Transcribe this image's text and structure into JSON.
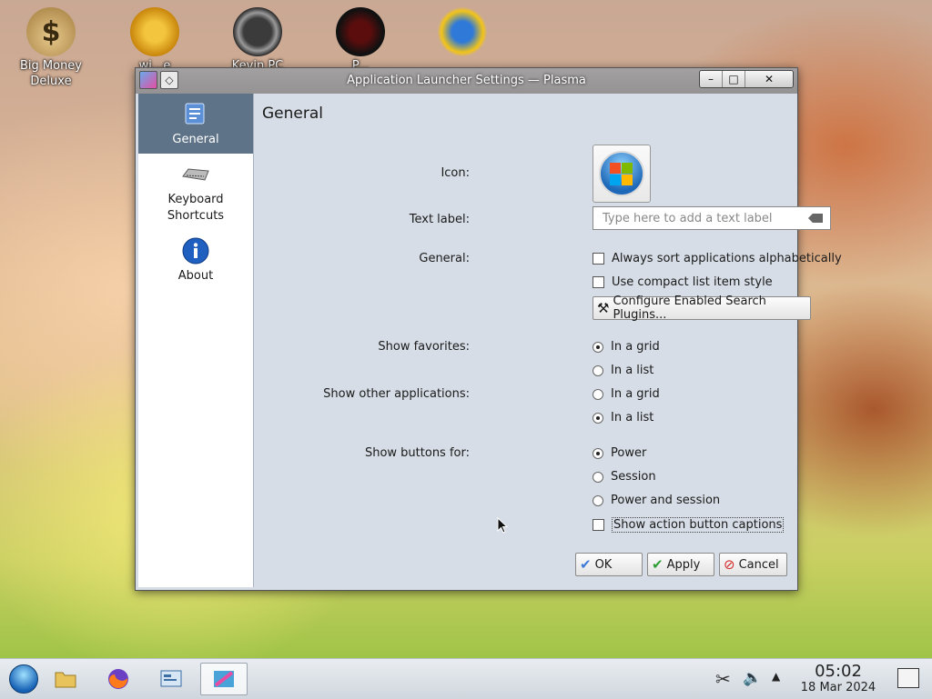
{
  "desktop": {
    "icons": [
      {
        "label": "Big Money\nDeluxe",
        "icon": "money-bag-icon"
      },
      {
        "label": "wi...e\nruss...",
        "icon": "gear-icon"
      },
      {
        "label": "Kevin PC",
        "icon": "gauge-icon"
      },
      {
        "label": "P...",
        "icon": "spider-icon"
      },
      {
        "label": "",
        "icon": "sun-globe-icon"
      }
    ]
  },
  "window": {
    "title": "Application Launcher Settings — Plasma",
    "controls": {
      "minimize": "–",
      "maximize": "□",
      "close": "✕"
    }
  },
  "sidebar": {
    "items": [
      {
        "label": "General",
        "icon": "general-settings-icon",
        "active": true
      },
      {
        "label": "Keyboard\nShortcuts",
        "icon": "keyboard-icon",
        "active": false
      },
      {
        "label": "About",
        "icon": "info-icon",
        "active": false
      }
    ]
  },
  "page": {
    "title": "General",
    "icon_label": "Icon:",
    "text_label": "Text label:",
    "text_placeholder": "Type here to add a text label",
    "general_label": "General:",
    "sort_alpha": "Always sort applications alphabetically",
    "compact_list": "Use compact list item style",
    "configure_plugins": "Configure Enabled Search Plugins...",
    "show_favorites_label": "Show favorites:",
    "fav_grid": "In a grid",
    "fav_list": "In a list",
    "show_other_label": "Show other applications:",
    "other_grid": "In a grid",
    "other_list": "In a list",
    "show_buttons_label": "Show buttons for:",
    "btn_power": "Power",
    "btn_session": "Session",
    "btn_power_session": "Power and session",
    "show_captions": "Show action button captions"
  },
  "footer": {
    "ok": "OK",
    "apply": "Apply",
    "cancel": "Cancel"
  },
  "taskbar": {
    "time": "05:02",
    "date": "18 Mar 2024"
  }
}
